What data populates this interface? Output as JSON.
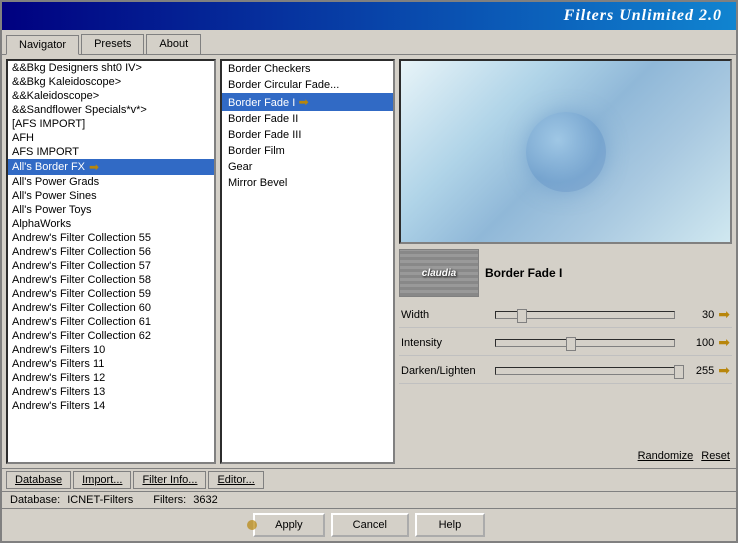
{
  "window": {
    "title": "Filters Unlimited 2.0"
  },
  "tabs": [
    {
      "label": "Navigator",
      "active": true
    },
    {
      "label": "Presets",
      "active": false
    },
    {
      "label": "About",
      "active": false
    }
  ],
  "nav_items": [
    {
      "label": "&&Bkg Designers sht0 IV>",
      "selected": false
    },
    {
      "label": "&&Bkg Kaleidoscope>",
      "selected": false
    },
    {
      "label": "&&Kaleidoscope>",
      "selected": false
    },
    {
      "label": "&&Sandflower Specials*v*>",
      "selected": false
    },
    {
      "label": "[AFS IMPORT]",
      "selected": false
    },
    {
      "label": "AFH",
      "selected": false
    },
    {
      "label": "AFS IMPORT",
      "selected": false
    },
    {
      "label": "All's Border FX",
      "selected": true,
      "arrow": true
    },
    {
      "label": "All's Power Grads",
      "selected": false
    },
    {
      "label": "All's Power Sines",
      "selected": false
    },
    {
      "label": "All's Power Toys",
      "selected": false
    },
    {
      "label": "AlphaWorks",
      "selected": false
    },
    {
      "label": "Andrew's Filter Collection 55",
      "selected": false
    },
    {
      "label": "Andrew's Filter Collection 56",
      "selected": false
    },
    {
      "label": "Andrew's Filter Collection 57",
      "selected": false
    },
    {
      "label": "Andrew's Filter Collection 58",
      "selected": false
    },
    {
      "label": "Andrew's Filter Collection 59",
      "selected": false
    },
    {
      "label": "Andrew's Filter Collection 60",
      "selected": false
    },
    {
      "label": "Andrew's Filter Collection 61",
      "selected": false
    },
    {
      "label": "Andrew's Filter Collection 62",
      "selected": false
    },
    {
      "label": "Andrew's Filters 10",
      "selected": false
    },
    {
      "label": "Andrew's Filters 11",
      "selected": false
    },
    {
      "label": "Andrew's Filters 12",
      "selected": false
    },
    {
      "label": "Andrew's Filters 13",
      "selected": false
    },
    {
      "label": "Andrew's Filters 14",
      "selected": false
    }
  ],
  "filter_items": [
    {
      "label": "Border Checkers",
      "selected": false
    },
    {
      "label": "Border Circular Fade...",
      "selected": false
    },
    {
      "label": "Border Fade I",
      "selected": true,
      "arrow": true
    },
    {
      "label": "Border Fade II",
      "selected": false
    },
    {
      "label": "Border Fade III",
      "selected": false
    },
    {
      "label": "Border Film",
      "selected": false
    },
    {
      "label": "Gear",
      "selected": false
    },
    {
      "label": "Mirror Bevel",
      "selected": false
    }
  ],
  "preview": {
    "label": "preview-area"
  },
  "thumbnail": {
    "text": "claudia"
  },
  "filter_name": "Border Fade I",
  "sliders": [
    {
      "label": "Width",
      "value": 30,
      "percent": 12
    },
    {
      "label": "Intensity",
      "value": 100,
      "percent": 39
    },
    {
      "label": "Darken/Lighten",
      "value": 255,
      "percent": 100
    }
  ],
  "toolbar": {
    "database_label": "Database",
    "import_label": "Import...",
    "filter_info_label": "Filter Info...",
    "editor_label": "Editor...",
    "randomize_label": "Randomize",
    "reset_label": "Reset"
  },
  "action_buttons": {
    "apply_label": "Apply",
    "cancel_label": "Cancel",
    "help_label": "Help"
  },
  "status": {
    "database_label": "Database:",
    "database_value": "ICNET-Filters",
    "filters_label": "Filters:",
    "filters_value": "3632"
  }
}
